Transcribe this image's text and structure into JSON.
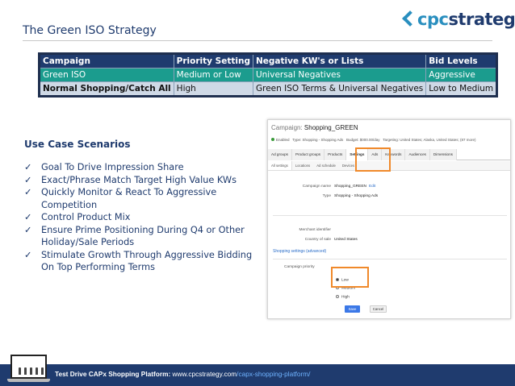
{
  "slide": {
    "title": "The Green ISO Strategy"
  },
  "logo": {
    "cpc": "cpc",
    "strategy": "strategy"
  },
  "campaign_table": {
    "headers": [
      "Campaign",
      "Priority Setting",
      "Negative KW's or Lists",
      "Bid Levels"
    ],
    "rows": [
      [
        "Green ISO",
        "Medium or Low",
        "Universal Negatives",
        "Aggressive"
      ],
      [
        "Normal Shopping/Catch All",
        "High",
        "Green ISO Terms & Universal Negatives",
        "Low to Medium"
      ]
    ]
  },
  "use_cases": {
    "heading": "Use Case Scenarios",
    "items": [
      "Goal To Drive Impression Share",
      "Exact/Phrase Match Target High Value KWs",
      "Quickly Monitor & React To Aggressive Competition",
      "Control Product Mix",
      "Ensure Prime Positioning During Q4 or Other Holiday/Sale Periods",
      "Stimulate Growth Through Aggressive Bidding On Top Performing Terms"
    ]
  },
  "screenshot": {
    "campaign_label": "Campaign:",
    "campaign_name": "Shopping_GREEN",
    "status": "Enabled",
    "type_text": "Type: Shopping - Shopping Ads",
    "budget_text": "Budget: $000.00/day",
    "targeting_text": "Targeting: United States; Alaska, United States; (87 more)",
    "tabs": [
      "Ad groups",
      "Product groups",
      "Products",
      "Settings",
      "Ads",
      "Keywords",
      "Audiences",
      "Dimensions"
    ],
    "active_tab": "Settings",
    "subtabs": [
      "All settings",
      "Locations",
      "Ad schedule",
      "Devices"
    ],
    "fields": {
      "campaign_name_label": "Campaign name",
      "campaign_name_value": "Shopping_GREEN",
      "edit_label": "Edit",
      "type_label": "Type",
      "type_value": "Shopping - Shopping Ads",
      "merchant_label": "Merchant identifier",
      "country_label": "Country of sale",
      "country_value": "United States"
    },
    "shopping_settings_link": "Shopping settings (advanced)",
    "priority_label": "Campaign priority",
    "priority_options": [
      "Low",
      "Medium",
      "High"
    ],
    "selected_priority": "Low",
    "save_label": "Save",
    "cancel_label": "Cancel"
  },
  "footer": {
    "bold_text": "Test Drive CAPx Shopping Platform:",
    "domain_text": " www.cpcstrategy.com",
    "link_text": "/capx-shopping-platform/"
  },
  "colors": {
    "brand_navy": "#1f3b6e",
    "brand_blue": "#2a8fbf",
    "green_row": "#1b9c8e",
    "highlight_orange": "#f0892a"
  }
}
